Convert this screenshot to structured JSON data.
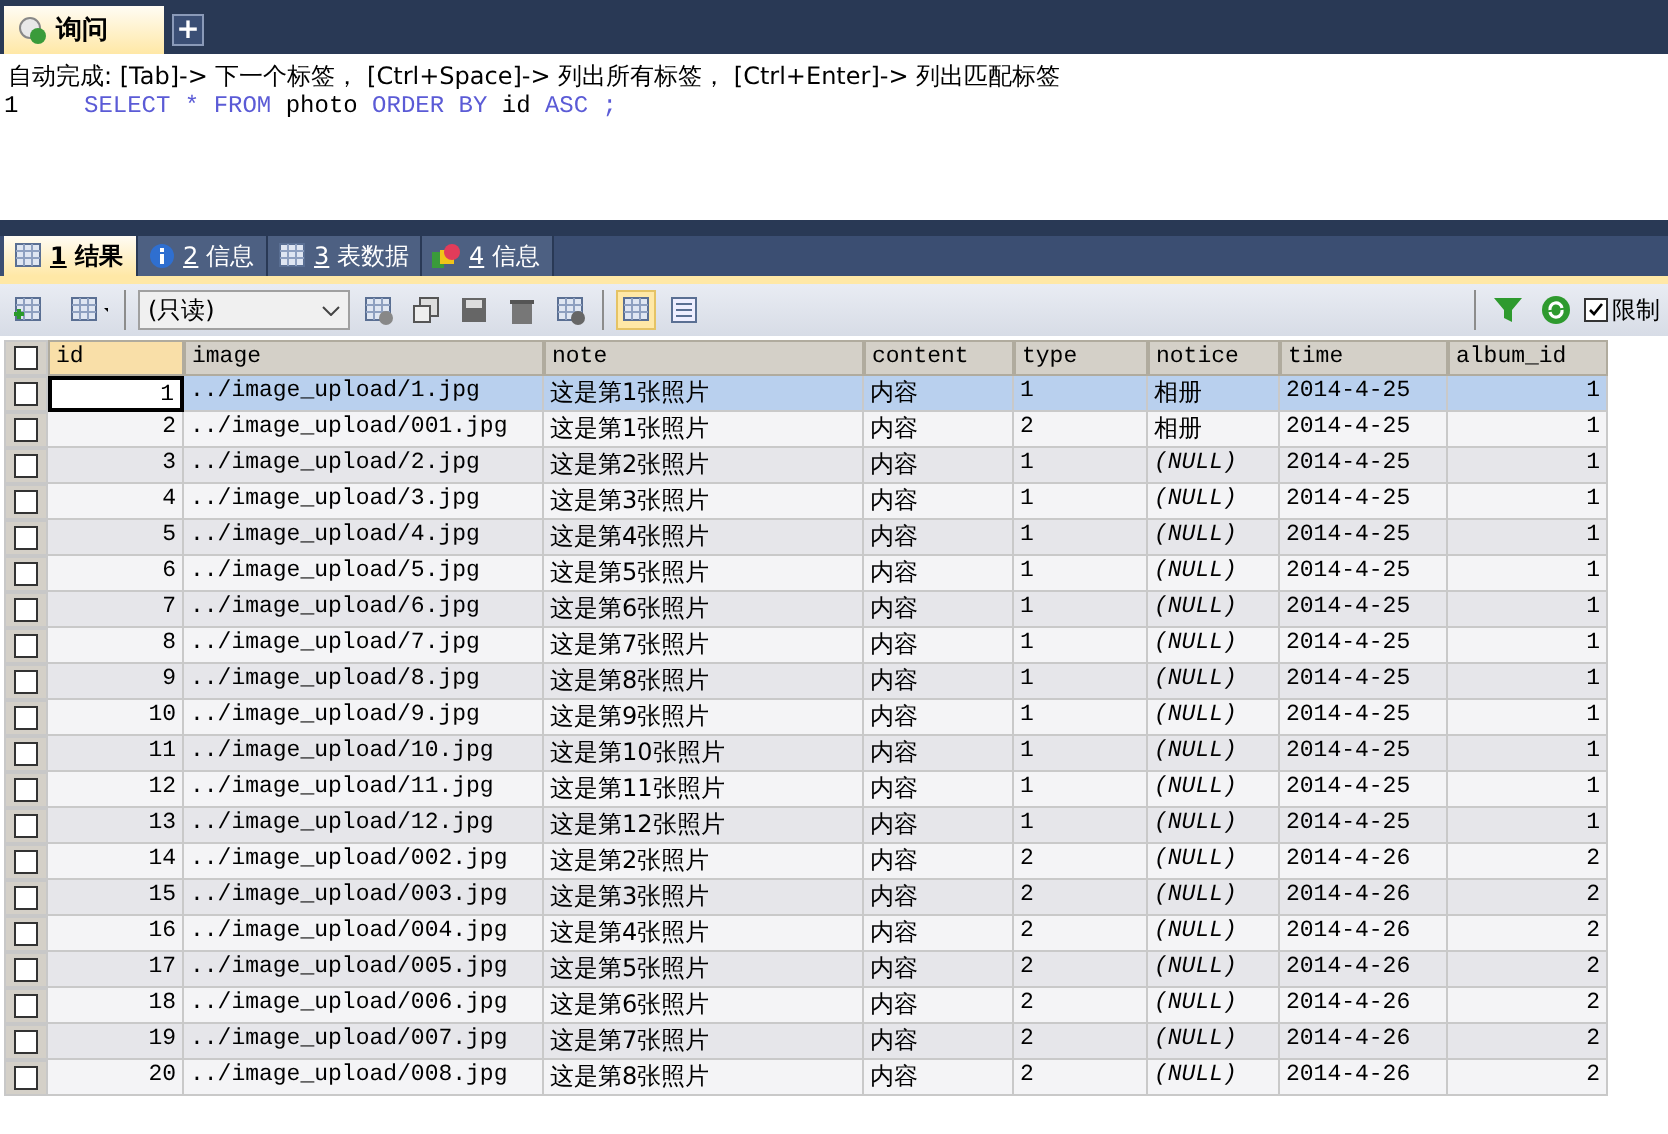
{
  "editor_tabs": [
    {
      "label": "询问",
      "selected": true
    }
  ],
  "new_tab_button": "+",
  "hint": "自动完成: [Tab]-> 下一个标签， [Ctrl+Space]-> 列出所有标签， [Ctrl+Enter]-> 列出匹配标签",
  "editor": {
    "line_number": "1",
    "query": [
      {
        "text": "SELECT",
        "kind": "keyword"
      },
      {
        "text": "*",
        "kind": "keyword"
      },
      {
        "text": "FROM",
        "kind": "keyword"
      },
      {
        "text": "photo",
        "kind": "plain"
      },
      {
        "text": "ORDER BY",
        "kind": "keyword"
      },
      {
        "text": "id",
        "kind": "plain"
      },
      {
        "text": "ASC",
        "kind": "keyword"
      },
      {
        "text": ";",
        "kind": "keyword"
      }
    ]
  },
  "result_tabs": [
    {
      "number": "1",
      "label": "结果",
      "selected": true
    },
    {
      "number": "2",
      "label": "信息",
      "selected": false
    },
    {
      "number": "3",
      "label": "表数据",
      "selected": false
    },
    {
      "number": "4",
      "label": "信息",
      "selected": false
    }
  ],
  "toolbar": {
    "mode": "(只读)",
    "grid_view_selected": true,
    "limit_label": "限制",
    "limit_checked": true
  },
  "table": {
    "header_checked": false,
    "columns": [
      "id",
      "image",
      "note",
      "content",
      "type",
      "notice",
      "time",
      "album_id"
    ],
    "rows": [
      {
        "selected": true,
        "checked": false,
        "notice_null": false,
        "cells": [
          "1",
          "../image_upload/1.jpg",
          "这是第1张照片",
          "内容",
          "1",
          "相册",
          "2014-4-25",
          "1"
        ]
      },
      {
        "selected": false,
        "checked": false,
        "notice_null": false,
        "cells": [
          "2",
          "../image_upload/001.jpg",
          "这是第1张照片",
          "内容",
          "2",
          "相册",
          "2014-4-25",
          "1"
        ]
      },
      {
        "selected": false,
        "checked": false,
        "notice_null": true,
        "cells": [
          "3",
          "../image_upload/2.jpg",
          "这是第2张照片",
          "内容",
          "1",
          "(NULL)",
          "2014-4-25",
          "1"
        ]
      },
      {
        "selected": false,
        "checked": false,
        "notice_null": true,
        "cells": [
          "4",
          "../image_upload/3.jpg",
          "这是第3张照片",
          "内容",
          "1",
          "(NULL)",
          "2014-4-25",
          "1"
        ]
      },
      {
        "selected": false,
        "checked": false,
        "notice_null": true,
        "cells": [
          "5",
          "../image_upload/4.jpg",
          "这是第4张照片",
          "内容",
          "1",
          "(NULL)",
          "2014-4-25",
          "1"
        ]
      },
      {
        "selected": false,
        "checked": false,
        "notice_null": true,
        "cells": [
          "6",
          "../image_upload/5.jpg",
          "这是第5张照片",
          "内容",
          "1",
          "(NULL)",
          "2014-4-25",
          "1"
        ]
      },
      {
        "selected": false,
        "checked": false,
        "notice_null": true,
        "cells": [
          "7",
          "../image_upload/6.jpg",
          "这是第6张照片",
          "内容",
          "1",
          "(NULL)",
          "2014-4-25",
          "1"
        ]
      },
      {
        "selected": false,
        "checked": false,
        "notice_null": true,
        "cells": [
          "8",
          "../image_upload/7.jpg",
          "这是第7张照片",
          "内容",
          "1",
          "(NULL)",
          "2014-4-25",
          "1"
        ]
      },
      {
        "selected": false,
        "checked": false,
        "notice_null": true,
        "cells": [
          "9",
          "../image_upload/8.jpg",
          "这是第8张照片",
          "内容",
          "1",
          "(NULL)",
          "2014-4-25",
          "1"
        ]
      },
      {
        "selected": false,
        "checked": false,
        "notice_null": true,
        "cells": [
          "10",
          "../image_upload/9.jpg",
          "这是第9张照片",
          "内容",
          "1",
          "(NULL)",
          "2014-4-25",
          "1"
        ]
      },
      {
        "selected": false,
        "checked": false,
        "notice_null": true,
        "cells": [
          "11",
          "../image_upload/10.jpg",
          "这是第10张照片",
          "内容",
          "1",
          "(NULL)",
          "2014-4-25",
          "1"
        ]
      },
      {
        "selected": false,
        "checked": false,
        "notice_null": true,
        "cells": [
          "12",
          "../image_upload/11.jpg",
          "这是第11张照片",
          "内容",
          "1",
          "(NULL)",
          "2014-4-25",
          "1"
        ]
      },
      {
        "selected": false,
        "checked": false,
        "notice_null": true,
        "cells": [
          "13",
          "../image_upload/12.jpg",
          "这是第12张照片",
          "内容",
          "1",
          "(NULL)",
          "2014-4-25",
          "1"
        ]
      },
      {
        "selected": false,
        "checked": false,
        "notice_null": true,
        "cells": [
          "14",
          "../image_upload/002.jpg",
          "这是第2张照片",
          "内容",
          "2",
          "(NULL)",
          "2014-4-26",
          "2"
        ]
      },
      {
        "selected": false,
        "checked": false,
        "notice_null": true,
        "cells": [
          "15",
          "../image_upload/003.jpg",
          "这是第3张照片",
          "内容",
          "2",
          "(NULL)",
          "2014-4-26",
          "2"
        ]
      },
      {
        "selected": false,
        "checked": false,
        "notice_null": true,
        "cells": [
          "16",
          "../image_upload/004.jpg",
          "这是第4张照片",
          "内容",
          "2",
          "(NULL)",
          "2014-4-26",
          "2"
        ]
      },
      {
        "selected": false,
        "checked": false,
        "notice_null": true,
        "cells": [
          "17",
          "../image_upload/005.jpg",
          "这是第5张照片",
          "内容",
          "2",
          "(NULL)",
          "2014-4-26",
          "2"
        ]
      },
      {
        "selected": false,
        "checked": false,
        "notice_null": true,
        "cells": [
          "18",
          "../image_upload/006.jpg",
          "这是第6张照片",
          "内容",
          "2",
          "(NULL)",
          "2014-4-26",
          "2"
        ]
      },
      {
        "selected": false,
        "checked": false,
        "notice_null": true,
        "cells": [
          "19",
          "../image_upload/007.jpg",
          "这是第7张照片",
          "内容",
          "2",
          "(NULL)",
          "2014-4-26",
          "2"
        ]
      },
      {
        "selected": false,
        "checked": false,
        "notice_null": true,
        "cells": [
          "20",
          "../image_upload/008.jpg",
          "这是第8张照片",
          "内容",
          "2",
          "(NULL)",
          "2014-4-26",
          "2"
        ]
      }
    ]
  }
}
